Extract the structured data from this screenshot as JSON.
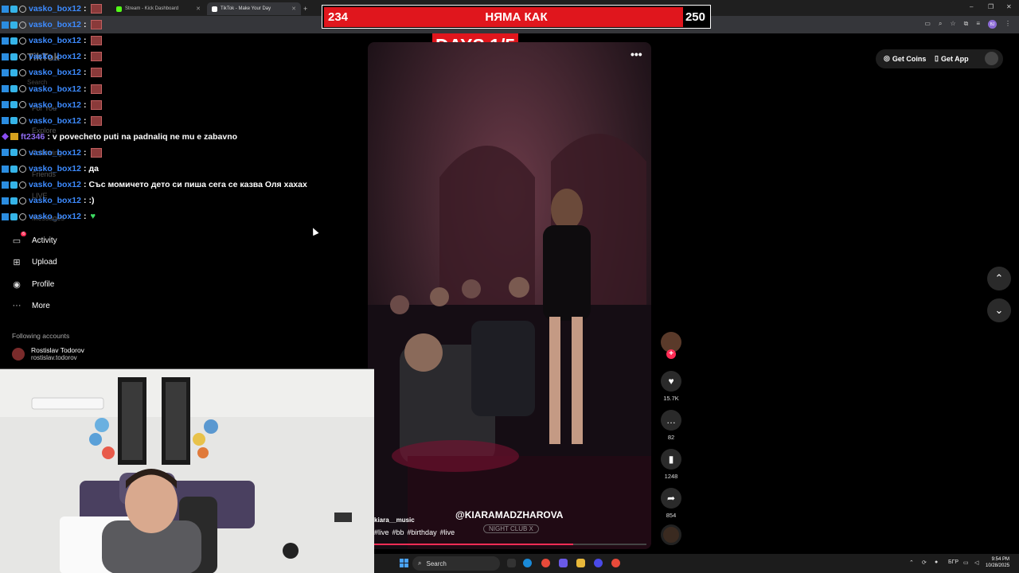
{
  "browser": {
    "tabs": [
      {
        "label": "Stream - Kick Dashboard",
        "color": "#53fc18"
      },
      {
        "label": "TikTok - Make Your Day",
        "color": "#ffffff"
      }
    ],
    "new_tab": "+",
    "window_controls": [
      "–",
      "❐",
      "✕"
    ],
    "profile_initials": "BJ"
  },
  "tiktok": {
    "logo": "TikTok",
    "search_placeholder": "Search",
    "faded_nav": [
      "For You",
      "Explore",
      "Following",
      "Friends",
      "LIVE",
      "Messages"
    ],
    "nav": [
      {
        "label": "Activity",
        "icon": "activity-icon",
        "glyph": "▭",
        "badge": "6"
      },
      {
        "label": "Upload",
        "icon": "upload-icon",
        "glyph": "⊞"
      },
      {
        "label": "Profile",
        "icon": "profile-icon",
        "glyph": "◉"
      },
      {
        "label": "More",
        "icon": "more-icon",
        "glyph": "···"
      }
    ],
    "following_heading": "Following accounts",
    "following": [
      {
        "name": "Rostislav Todorov",
        "handle": "rostislav.todorov"
      }
    ],
    "header": {
      "get_coins": "Get Coins",
      "get_app": "Get App"
    },
    "nav_up": "⌃",
    "nav_down": "⌄"
  },
  "chat": [
    {
      "user": "vasko_box12",
      "msg": "",
      "emote": true,
      "heart": false,
      "color": "blue"
    },
    {
      "user": "vasko_box12",
      "msg": "",
      "emote": true,
      "heart": false,
      "color": "blue"
    },
    {
      "user": "vasko_box12",
      "msg": "",
      "emote": true,
      "heart": false,
      "color": "blue"
    },
    {
      "user": "vasko_box12",
      "msg": "",
      "emote": true,
      "heart": false,
      "color": "blue"
    },
    {
      "user": "vasko_box12",
      "msg": "",
      "emote": true,
      "heart": false,
      "color": "blue"
    },
    {
      "user": "vasko_box12",
      "msg": "",
      "emote": true,
      "heart": false,
      "color": "blue"
    },
    {
      "user": "vasko_box12",
      "msg": "",
      "emote": true,
      "heart": false,
      "color": "blue"
    },
    {
      "user": "vasko_box12",
      "msg": "",
      "emote": true,
      "heart": false,
      "color": "blue"
    },
    {
      "user": "ft2346",
      "msg": "v povecheto puti na padnaliq ne mu e zabavno",
      "emote": false,
      "heart": false,
      "color": "purple"
    },
    {
      "user": "vasko_box12",
      "msg": "",
      "emote": true,
      "heart": false,
      "color": "blue"
    },
    {
      "user": "vasko_box12",
      "msg": "да",
      "emote": false,
      "heart": false,
      "color": "blue"
    },
    {
      "user": "vasko_box12",
      "msg": "Със момичето дето си пиша сега се казва Оля хахах",
      "emote": false,
      "heart": false,
      "color": "blue"
    },
    {
      "user": "vasko_box12",
      "msg": ":)",
      "emote": false,
      "heart": false,
      "color": "blue"
    },
    {
      "user": "vasko_box12",
      "msg": "",
      "emote": false,
      "heart": true,
      "color": "blue"
    }
  ],
  "banner": {
    "left": "234",
    "title": "НЯМА КАК",
    "right": "250",
    "fill_fraction": 0.93,
    "color": "#e0161d"
  },
  "days_label": "DAYS  1/5",
  "video": {
    "more": "•••",
    "watermark": "@KIARAMADZHAROVA",
    "brand_tag": "NIGHT CLUB X",
    "author": "kiara__music",
    "tags": [
      "#live",
      "#bb",
      "#birthday",
      "#live"
    ],
    "progress_fraction": 0.73
  },
  "actions": [
    {
      "name": "like",
      "glyph": "♥",
      "count": "15.7K"
    },
    {
      "name": "comment",
      "glyph": "…",
      "count": "82"
    },
    {
      "name": "bookmark",
      "glyph": "▮",
      "count": "1248"
    },
    {
      "name": "share",
      "glyph": "➦",
      "count": "854"
    }
  ],
  "taskbar": {
    "search": "Search",
    "lang": "БГР",
    "time": "9:54 PM",
    "date": "10/28/2025"
  }
}
